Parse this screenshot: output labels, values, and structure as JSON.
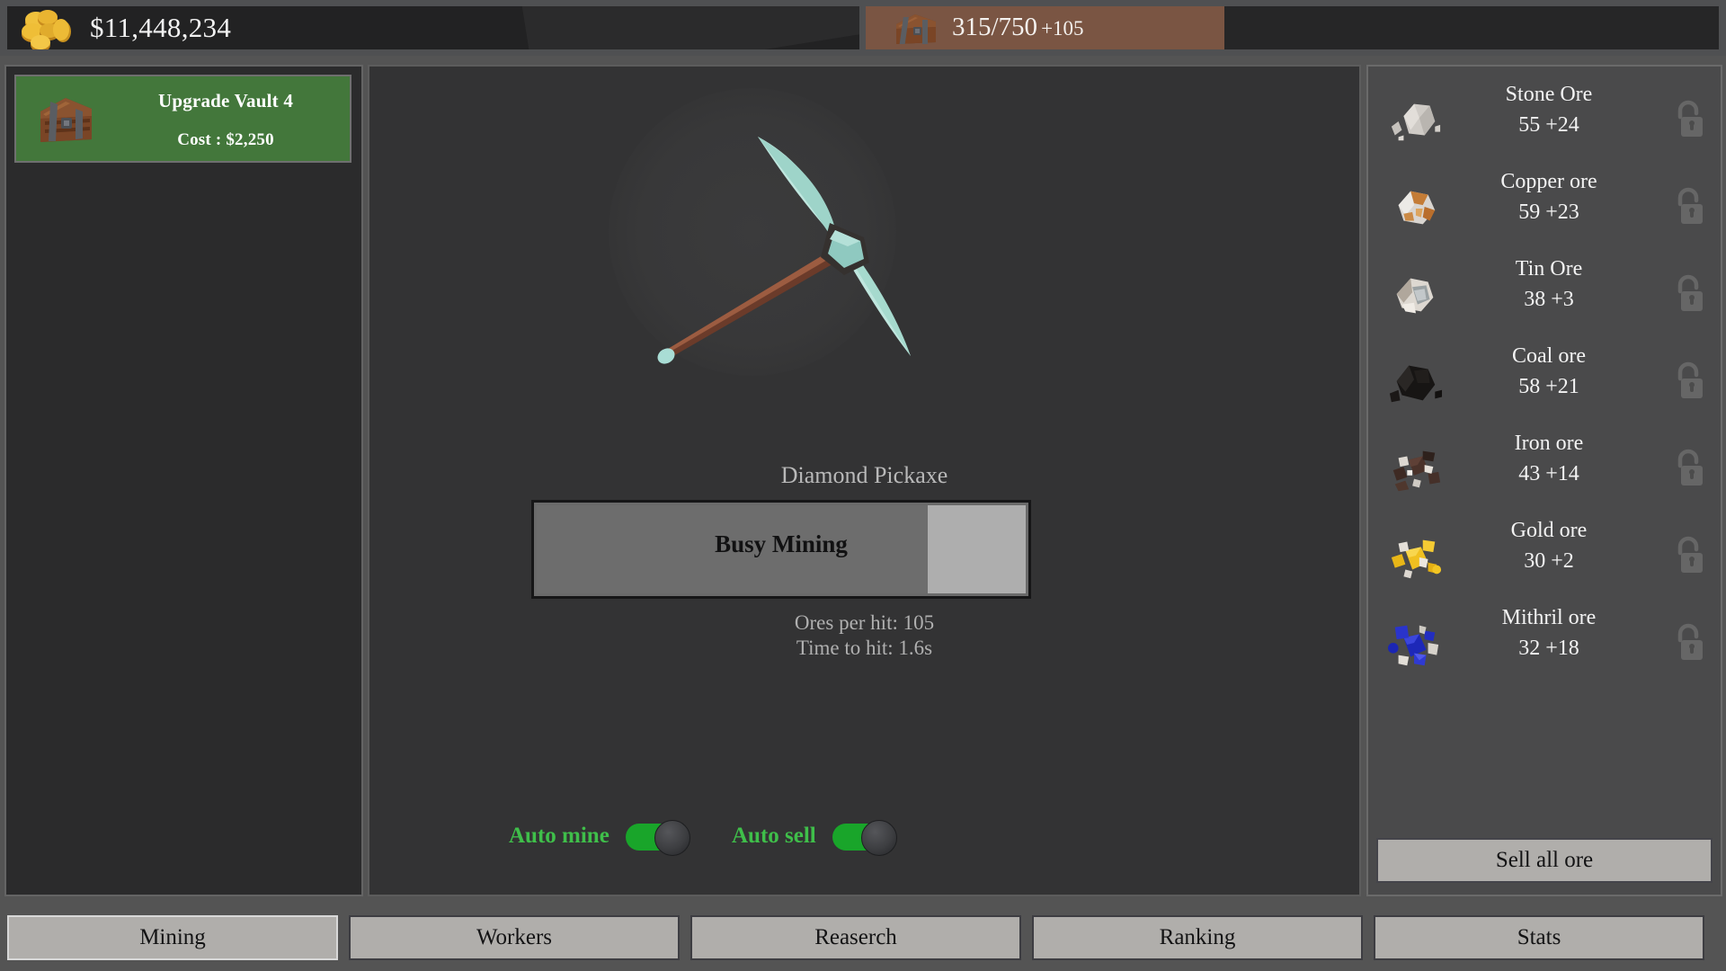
{
  "topbar": {
    "money": "$11,448,234",
    "money_icon": "gold-coins-icon",
    "vault_icon": "treasure-chest-icon",
    "vault_current": "315/750",
    "vault_gain": "+105",
    "vault_fill_percent": 42
  },
  "left_panel": {
    "upgrade": {
      "icon": "treasure-chest-icon",
      "title": "Upgrade Vault 4",
      "cost": "Cost : $2,250",
      "bg_color": "#43773b"
    }
  },
  "center_panel": {
    "pickaxe_icon": "diamond-pickaxe-icon",
    "pickaxe_name": "Diamond Pickaxe",
    "progress": {
      "label": "Busy Mining",
      "percent": 80
    },
    "stats": {
      "ores_per_hit": "Ores per hit: 105",
      "time_to_hit": "Time to hit: 1.6s"
    },
    "toggles": [
      {
        "label": "Auto mine",
        "state": "on"
      },
      {
        "label": "Auto sell",
        "state": "on"
      }
    ],
    "toggle_color": "#19a52a",
    "toggle_label_color": "#3fbf4a"
  },
  "right_panel": {
    "ores": [
      {
        "name": "Stone Ore",
        "count": "55 +24",
        "icon": "stone-ore-icon",
        "lock": "unlocked-padlock-icon"
      },
      {
        "name": "Copper ore",
        "count": "59 +23",
        "icon": "copper-ore-icon",
        "lock": "unlocked-padlock-icon"
      },
      {
        "name": "Tin Ore",
        "count": "38 +3",
        "icon": "tin-ore-icon",
        "lock": "unlocked-padlock-icon"
      },
      {
        "name": "Coal ore",
        "count": "58 +21",
        "icon": "coal-ore-icon",
        "lock": "unlocked-padlock-icon"
      },
      {
        "name": "Iron ore",
        "count": "43 +14",
        "icon": "iron-ore-icon",
        "lock": "unlocked-padlock-icon"
      },
      {
        "name": "Gold ore",
        "count": "30 +2",
        "icon": "gold-ore-icon",
        "lock": "unlocked-padlock-icon"
      },
      {
        "name": "Mithril ore",
        "count": "32 +18",
        "icon": "mithril-ore-icon",
        "lock": "unlocked-padlock-icon"
      }
    ],
    "sell_all_label": "Sell all ore"
  },
  "tabs": [
    {
      "label": "Mining",
      "active": true
    },
    {
      "label": "Workers",
      "active": false
    },
    {
      "label": "Reaserch",
      "active": false
    },
    {
      "label": "Ranking",
      "active": false
    },
    {
      "label": "Stats",
      "active": false
    }
  ]
}
